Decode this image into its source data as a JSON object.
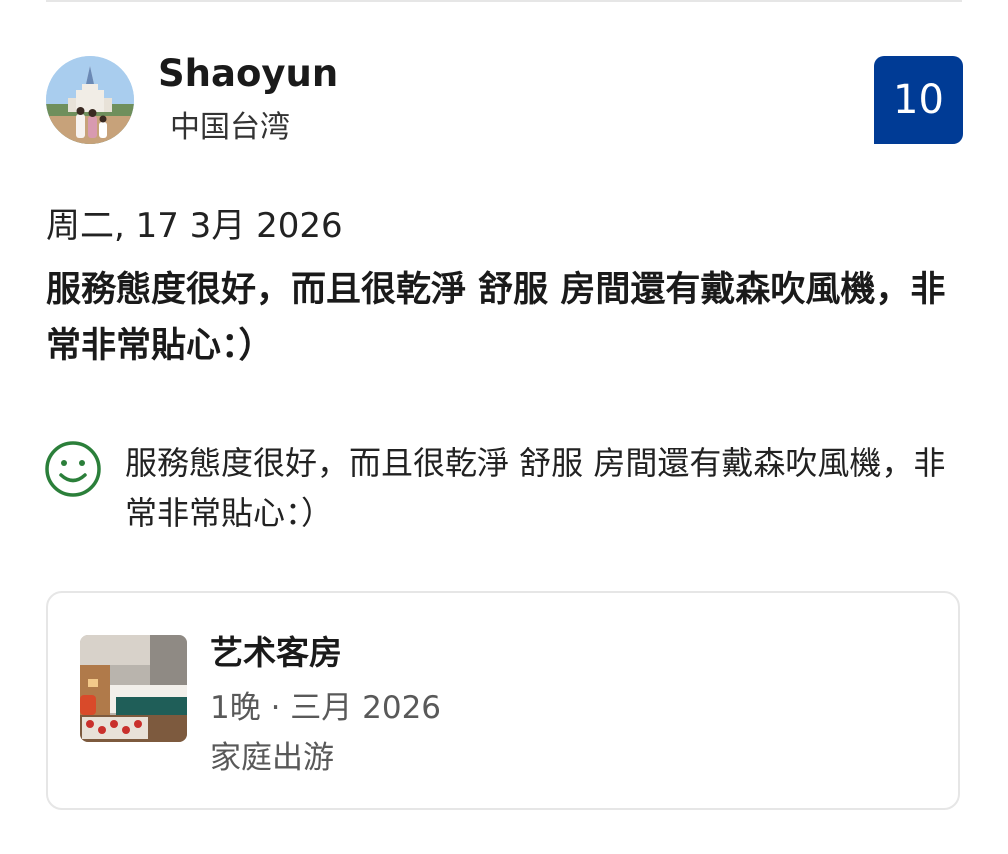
{
  "reviewer": {
    "name": "Shaoyun",
    "country": "中国台湾",
    "avatar": "avatar-castle-photo"
  },
  "score": {
    "value": "10",
    "color": "#003b95"
  },
  "review": {
    "date": "周二, 17 3月 2026",
    "title": "服務態度很好，而且很乾淨 舒服 房間還有戴森吹風機，非常非常貼心：）",
    "positive_icon": "smiley-icon",
    "positive_text": "服務態度很好，而且很乾淨 舒服 房間還有戴森吹風機，非常非常貼心：）",
    "positive_color": "#2b7f3a"
  },
  "stay": {
    "room_name": "艺术客房",
    "stay_info": "1晚 · 三月 2026",
    "traveler_type": "家庭出游",
    "thumbnail": "room-photo"
  }
}
